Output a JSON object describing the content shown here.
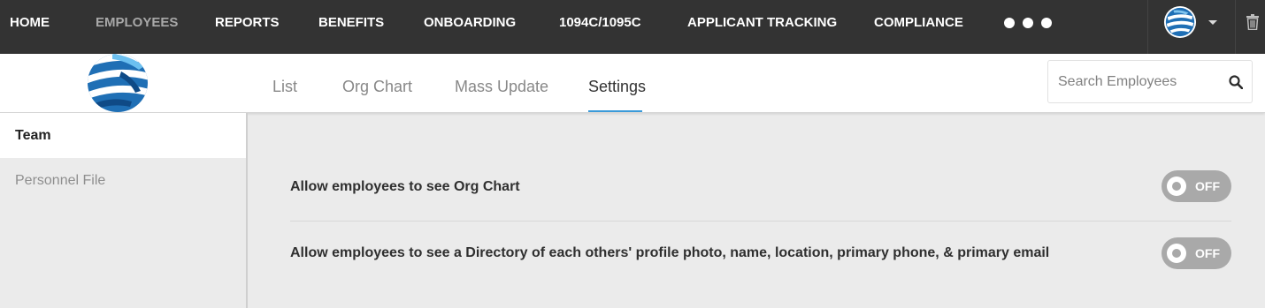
{
  "topnav": {
    "items": [
      {
        "label": "HOME"
      },
      {
        "label": "EMPLOYEES"
      },
      {
        "label": "REPORTS"
      },
      {
        "label": "BENEFITS"
      },
      {
        "label": "ONBOARDING"
      },
      {
        "label": "1094C/1095C"
      },
      {
        "label": "APPLICANT TRACKING"
      },
      {
        "label": "COMPLIANCE"
      }
    ],
    "active": "EMPLOYEES",
    "more_icon": "more-dots-icon",
    "user_icon": "globe-avatar-icon",
    "caret_icon": "caret-down-icon",
    "trash_icon": "trash-icon"
  },
  "subheader": {
    "logo_icon": "globe-logo-icon",
    "tabs": [
      {
        "label": "List"
      },
      {
        "label": "Org Chart"
      },
      {
        "label": "Mass Update"
      },
      {
        "label": "Settings"
      }
    ],
    "active_tab": "Settings",
    "search": {
      "placeholder": "Search Employees",
      "value": "",
      "icon": "search-icon"
    }
  },
  "sidebar": {
    "items": [
      {
        "label": "Team"
      },
      {
        "label": "Personnel File"
      }
    ],
    "active": "Team"
  },
  "settings": [
    {
      "label": "Allow employees to see Org Chart",
      "toggle": "OFF"
    },
    {
      "label": "Allow employees to see a Directory of each others' profile photo, name, location, primary phone, & primary email",
      "toggle": "OFF"
    }
  ],
  "colors": {
    "nav_bg": "#333333",
    "nav_active": "#a8a8a8",
    "tab_underline": "#3a9ad9",
    "toggle_off": "#a9a9a9",
    "logo_blue": "#1f6fb5"
  }
}
